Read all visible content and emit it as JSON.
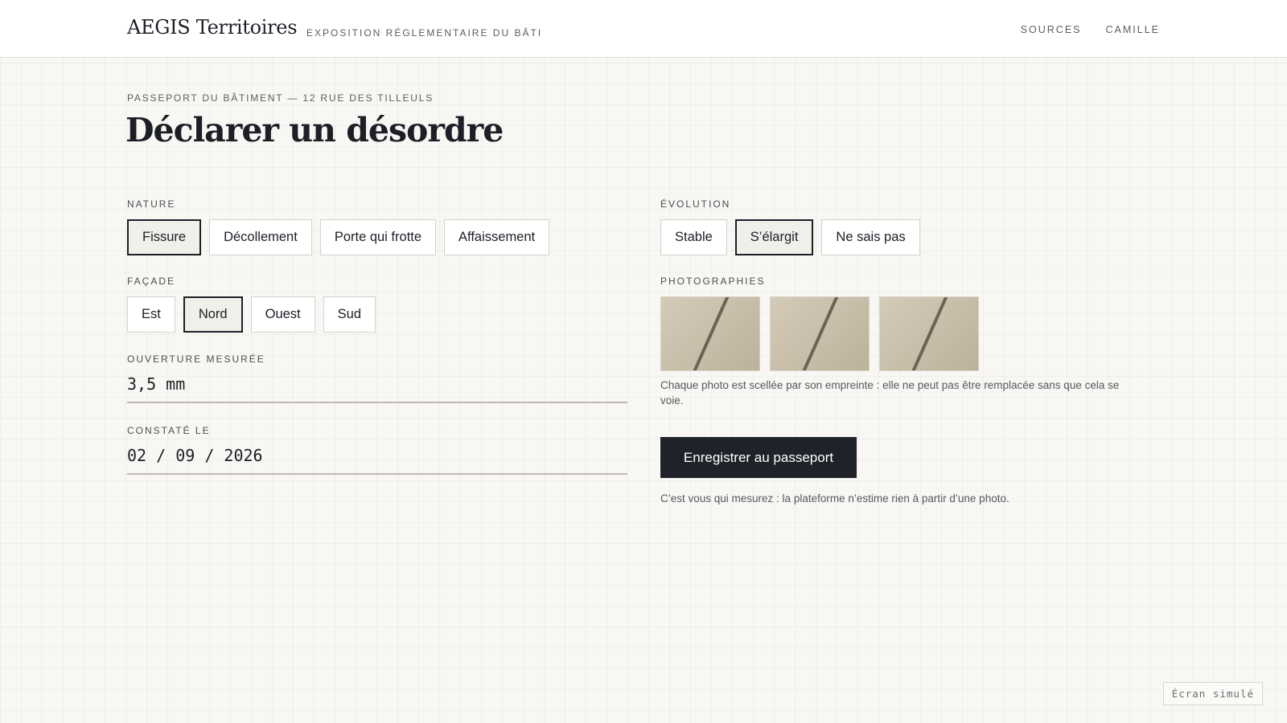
{
  "header": {
    "brand": "AEGIS Territoires",
    "subtitle": "EXPOSITION RÉGLEMENTAIRE DU BÂTI",
    "nav": [
      "SOURCES",
      "CAMILLE"
    ]
  },
  "page": {
    "eyebrow": "PASSEPORT DU BÂTIMENT — 12 RUE DES TILLEULS",
    "title": "Déclarer un désordre"
  },
  "nature": {
    "label": "NATURE",
    "options": [
      "Fissure",
      "Décollement",
      "Porte qui frotte",
      "Affaissement"
    ],
    "selected": "Fissure"
  },
  "facade": {
    "label": "FAÇADE",
    "options": [
      "Est",
      "Nord",
      "Ouest",
      "Sud"
    ],
    "selected": "Nord"
  },
  "ouverture": {
    "label": "OUVERTURE MESURÉE",
    "value": "3,5 mm"
  },
  "constate": {
    "label": "CONSTATÉ LE",
    "value": "02 / 09 / 2026"
  },
  "evolution": {
    "label": "ÉVOLUTION",
    "options": [
      "Stable",
      "S’élargit",
      "Ne sais pas"
    ],
    "selected": "S’élargit"
  },
  "photos": {
    "label": "PHOTOGRAPHIES",
    "count": 3,
    "note": "Chaque photo est scellée par son empreinte : elle ne peut pas être remplacée sans que cela se voie."
  },
  "submit": {
    "label": "Enregistrer au passeport",
    "note": "C’est vous qui mesurez : la plateforme n’estime rien à partir d’une photo."
  },
  "badge": "Écran simulé"
}
